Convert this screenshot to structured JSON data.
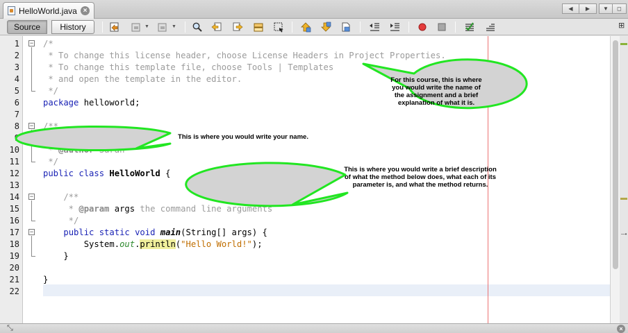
{
  "tab": {
    "title": "HelloWorld.java",
    "close": "×"
  },
  "tab_controls": {
    "prev": "◀",
    "next": "▶",
    "menu": "▼",
    "maximize": "◻"
  },
  "toolbar": {
    "source_label": "Source",
    "history_label": "History"
  },
  "side_control": "⊞",
  "line_numbers": [
    "1",
    "2",
    "3",
    "4",
    "5",
    "6",
    "7",
    "8",
    "9",
    "10",
    "11",
    "12",
    "13",
    "14",
    "15",
    "16",
    "17",
    "18",
    "19",
    "20",
    "21",
    "22"
  ],
  "code": {
    "l1": "/*",
    "l2": " * To change this license header, choose License Headers in Project Properties.",
    "l3": " * To change this template file, choose Tools | Templates",
    "l4": " * and open the template in the editor.",
    "l5": " */",
    "l6_kw": "package",
    "l6_rest": " helloworld;",
    "l8": "/**",
    "l9": " *",
    "l10_pre": " * ",
    "l10_tag": "@author",
    "l10_rest": " Sarah",
    "l11": " */",
    "l12_kw": "public class",
    "l12_name": " HelloWorld",
    "l12_rest": " {",
    "l14": "    /**",
    "l15_pre": "     * ",
    "l15_tag": "@param",
    "l15_arg": " args",
    "l15_rest": " the command line arguments",
    "l16": "     */",
    "l17_indent": "    ",
    "l17_kw": "public static void",
    "l17_sp": " ",
    "l17_name": "main",
    "l17_rest": "(String[] args) {",
    "l18_pre": "        System.",
    "l18_field": "out",
    "l18_dot": ".",
    "l18_method": "println",
    "l18_open": "(",
    "l18_str": "\"Hello World!\"",
    "l18_close": ");",
    "l19": "    }",
    "l21": "}"
  },
  "callouts": {
    "license": "For this course, this is where you would write the name of the assignment and a brief explanation of what it is.",
    "author": "This is where you would write your name.",
    "method": "This is where you would write a brief description of what the method below does, what each of its parameter is, and what the method returns."
  },
  "colors": {
    "callout_fill": "#d3d3d3",
    "callout_border": "#22e622",
    "keyword": "#1a23b5",
    "string": "#c06e00",
    "comment": "#9b9b9b",
    "margin_line": "#e85b5b"
  },
  "bottom": {
    "resize": "⤡",
    "close": "×"
  }
}
